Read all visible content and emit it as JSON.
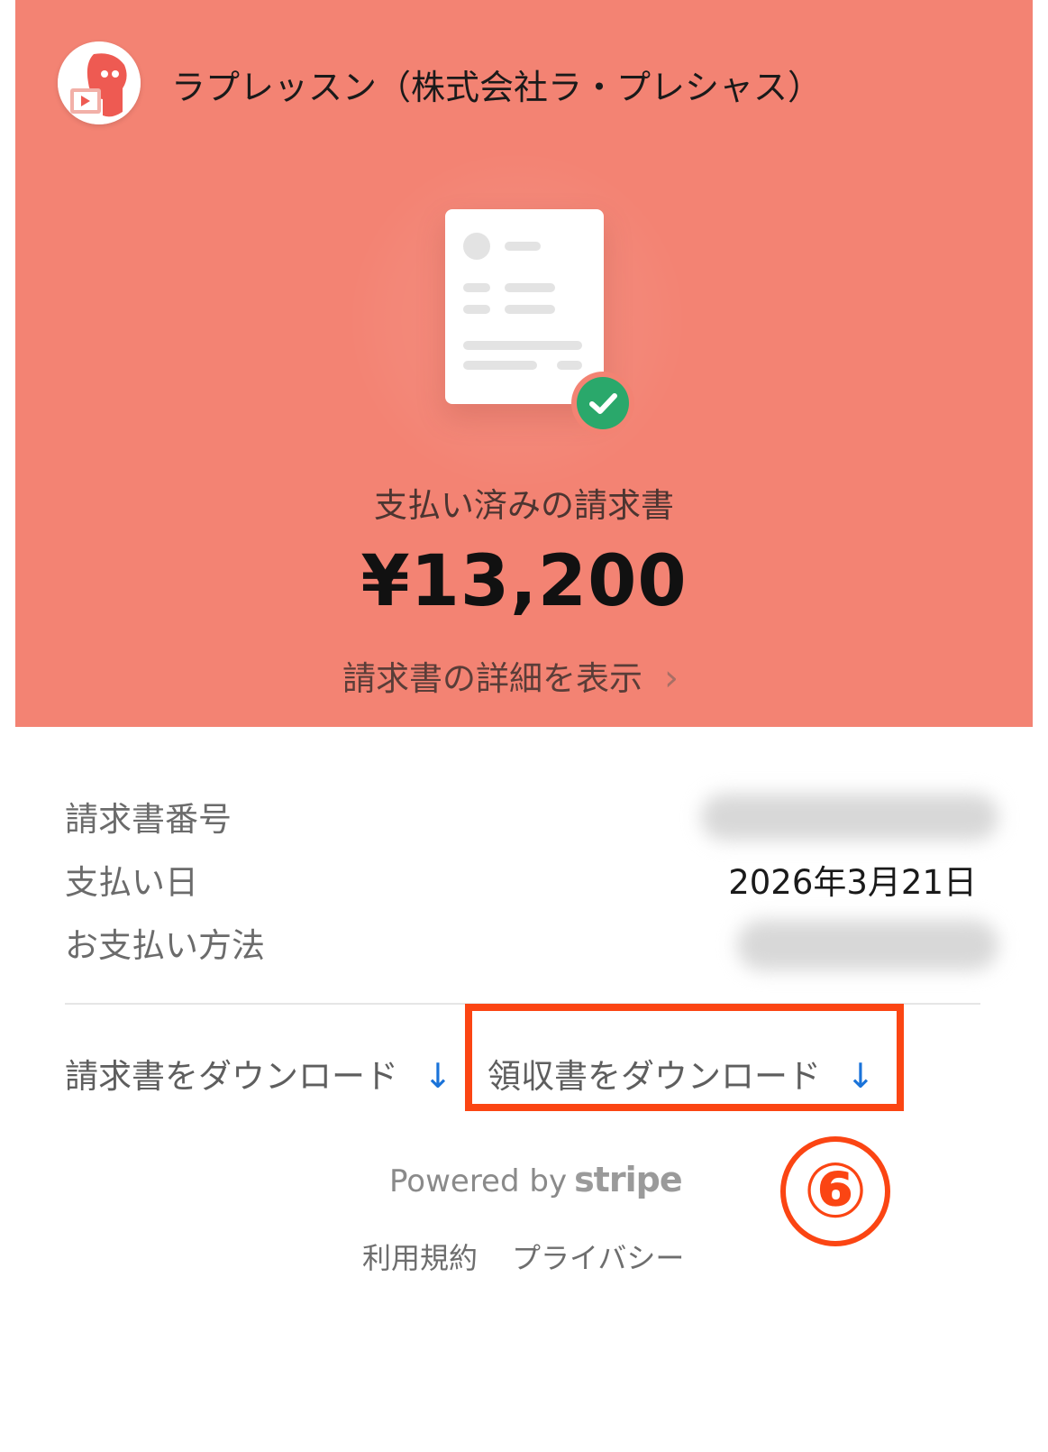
{
  "merchant": {
    "name": "ラプレッスン（株式会社ラ・プレシャス）",
    "avatar_icon": "merchant-avatar-icon"
  },
  "invoice": {
    "status": "支払い済みの請求書",
    "amount": "¥13,200",
    "details_link": "請求書の詳細を表示",
    "status_icon": "check-circle-icon",
    "document_icon": "invoice-document-icon"
  },
  "info": {
    "rows": [
      {
        "label": "請求書番号",
        "value": ""
      },
      {
        "label": "支払い日",
        "value": "2026年3月21日"
      },
      {
        "label": "お支払い方法",
        "value": ""
      }
    ]
  },
  "actions": {
    "download_invoice": "請求書をダウンロード",
    "download_receipt": "領収書をダウンロード",
    "arrow": "↓"
  },
  "annotation": {
    "step": "⑥",
    "color": "#fb4513"
  },
  "footer": {
    "powered_by": "Powered by",
    "brand": "stripe",
    "terms": "利用規約",
    "privacy": "プライバシー"
  },
  "colors": {
    "hero_bg": "#f38373",
    "check_green": "#2aa86b",
    "link_blue": "#1a73d9"
  }
}
